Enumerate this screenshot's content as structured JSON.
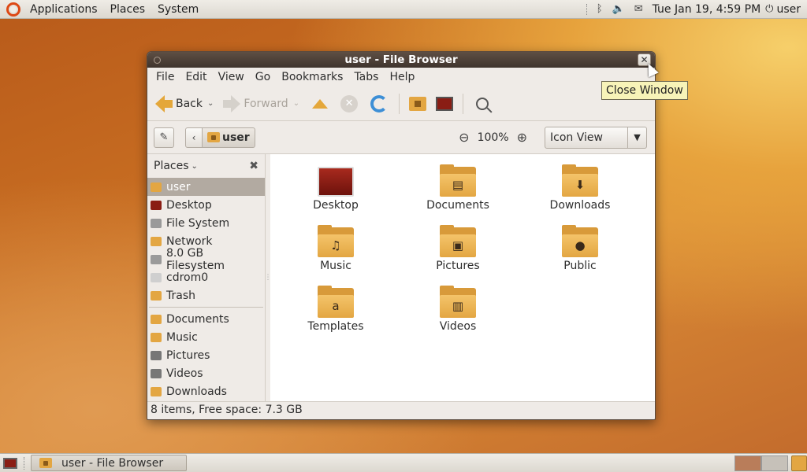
{
  "top_panel": {
    "menus": [
      "Applications",
      "Places",
      "System"
    ],
    "clock": "Tue Jan 19,  4:59 PM",
    "user": "user"
  },
  "window": {
    "title": "user - File Browser",
    "close_tooltip": "Close Window",
    "menubar": [
      "File",
      "Edit",
      "View",
      "Go",
      "Bookmarks",
      "Tabs",
      "Help"
    ],
    "toolbar": {
      "back_label": "Back",
      "forward_label": "Forward"
    },
    "location": {
      "crumb": "user",
      "zoom": "100%",
      "view_mode": "Icon View"
    },
    "sidebar": {
      "header": "Places",
      "places": [
        {
          "label": "user",
          "icon": "home-folder-icon",
          "color": "#e3a642"
        },
        {
          "label": "Desktop",
          "icon": "desktop-icon",
          "color": "#8a1d14"
        },
        {
          "label": "File System",
          "icon": "harddisk-icon",
          "color": "#9a9a9a"
        },
        {
          "label": "Network",
          "icon": "network-folder-icon",
          "color": "#e3a642"
        },
        {
          "label": "8.0 GB Filesystem",
          "icon": "drive-icon",
          "color": "#9a9a9a"
        },
        {
          "label": "cdrom0",
          "icon": "cdrom-icon",
          "color": "#cfcfcf"
        },
        {
          "label": "Trash",
          "icon": "trash-icon",
          "color": "#e3a642"
        }
      ],
      "bookmarks": [
        {
          "label": "Documents",
          "icon": "documents-folder-icon",
          "color": "#e3a642"
        },
        {
          "label": "Music",
          "icon": "music-folder-icon",
          "color": "#e3a642"
        },
        {
          "label": "Pictures",
          "icon": "pictures-folder-icon",
          "color": "#777777"
        },
        {
          "label": "Videos",
          "icon": "videos-folder-icon",
          "color": "#777777"
        },
        {
          "label": "Downloads",
          "icon": "downloads-folder-icon",
          "color": "#e3a642"
        }
      ]
    },
    "files": [
      {
        "label": "Desktop",
        "icon": "desktop-icon",
        "emblem": ""
      },
      {
        "label": "Documents",
        "icon": "documents-folder-icon",
        "emblem": "▤"
      },
      {
        "label": "Downloads",
        "icon": "downloads-folder-icon",
        "emblem": "⬇"
      },
      {
        "label": "Music",
        "icon": "music-folder-icon",
        "emblem": "♫"
      },
      {
        "label": "Pictures",
        "icon": "pictures-folder-icon",
        "emblem": "▣"
      },
      {
        "label": "Public",
        "icon": "public-folder-icon",
        "emblem": "●"
      },
      {
        "label": "Templates",
        "icon": "templates-folder-icon",
        "emblem": "a"
      },
      {
        "label": "Videos",
        "icon": "videos-folder-icon",
        "emblem": "▥"
      }
    ],
    "status": "8 items, Free space: 7.3 GB"
  },
  "bottom_panel": {
    "task": "user - File Browser"
  }
}
